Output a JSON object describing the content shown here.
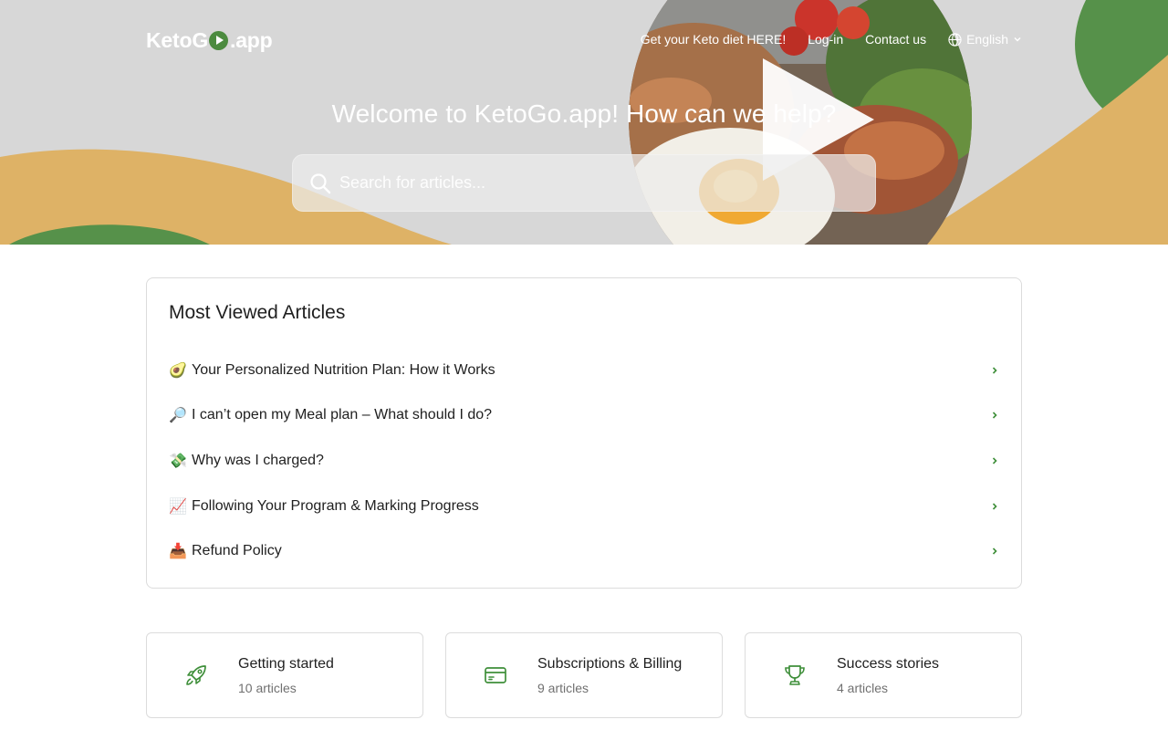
{
  "logo": {
    "part1": "Keto",
    "part2": "G",
    "part3": ".app"
  },
  "nav": {
    "get_diet": "Get your Keto diet HERE!",
    "login": "Log-in",
    "contact": "Contact us",
    "language": "English"
  },
  "hero": {
    "title": "Welcome to KetoGo.app! How can we help?",
    "search_placeholder": "Search for articles..."
  },
  "most_viewed": {
    "heading": "Most Viewed Articles",
    "articles": [
      {
        "emoji": "🥑",
        "title": "Your Personalized Nutrition Plan: How it Works"
      },
      {
        "emoji": "🔎",
        "title": "I can’t open my Meal plan – What should I do?"
      },
      {
        "emoji": "💸",
        "title": "Why was I charged?"
      },
      {
        "emoji": "📈",
        "title": "Following Your Program & Marking Progress"
      },
      {
        "emoji": "📥",
        "title": "Refund Policy"
      }
    ]
  },
  "categories": [
    {
      "icon": "rocket-icon",
      "name": "Getting started",
      "count": "10 articles"
    },
    {
      "icon": "credit-card-icon",
      "name": "Subscriptions & Billing",
      "count": "9 articles"
    },
    {
      "icon": "trophy-icon",
      "name": "Success stories",
      "count": "4 articles"
    }
  ],
  "colors": {
    "brand_green": "#4c8b3f",
    "brand_yellow": "#dcae5d",
    "hero_bg": "#d5d5d5"
  }
}
